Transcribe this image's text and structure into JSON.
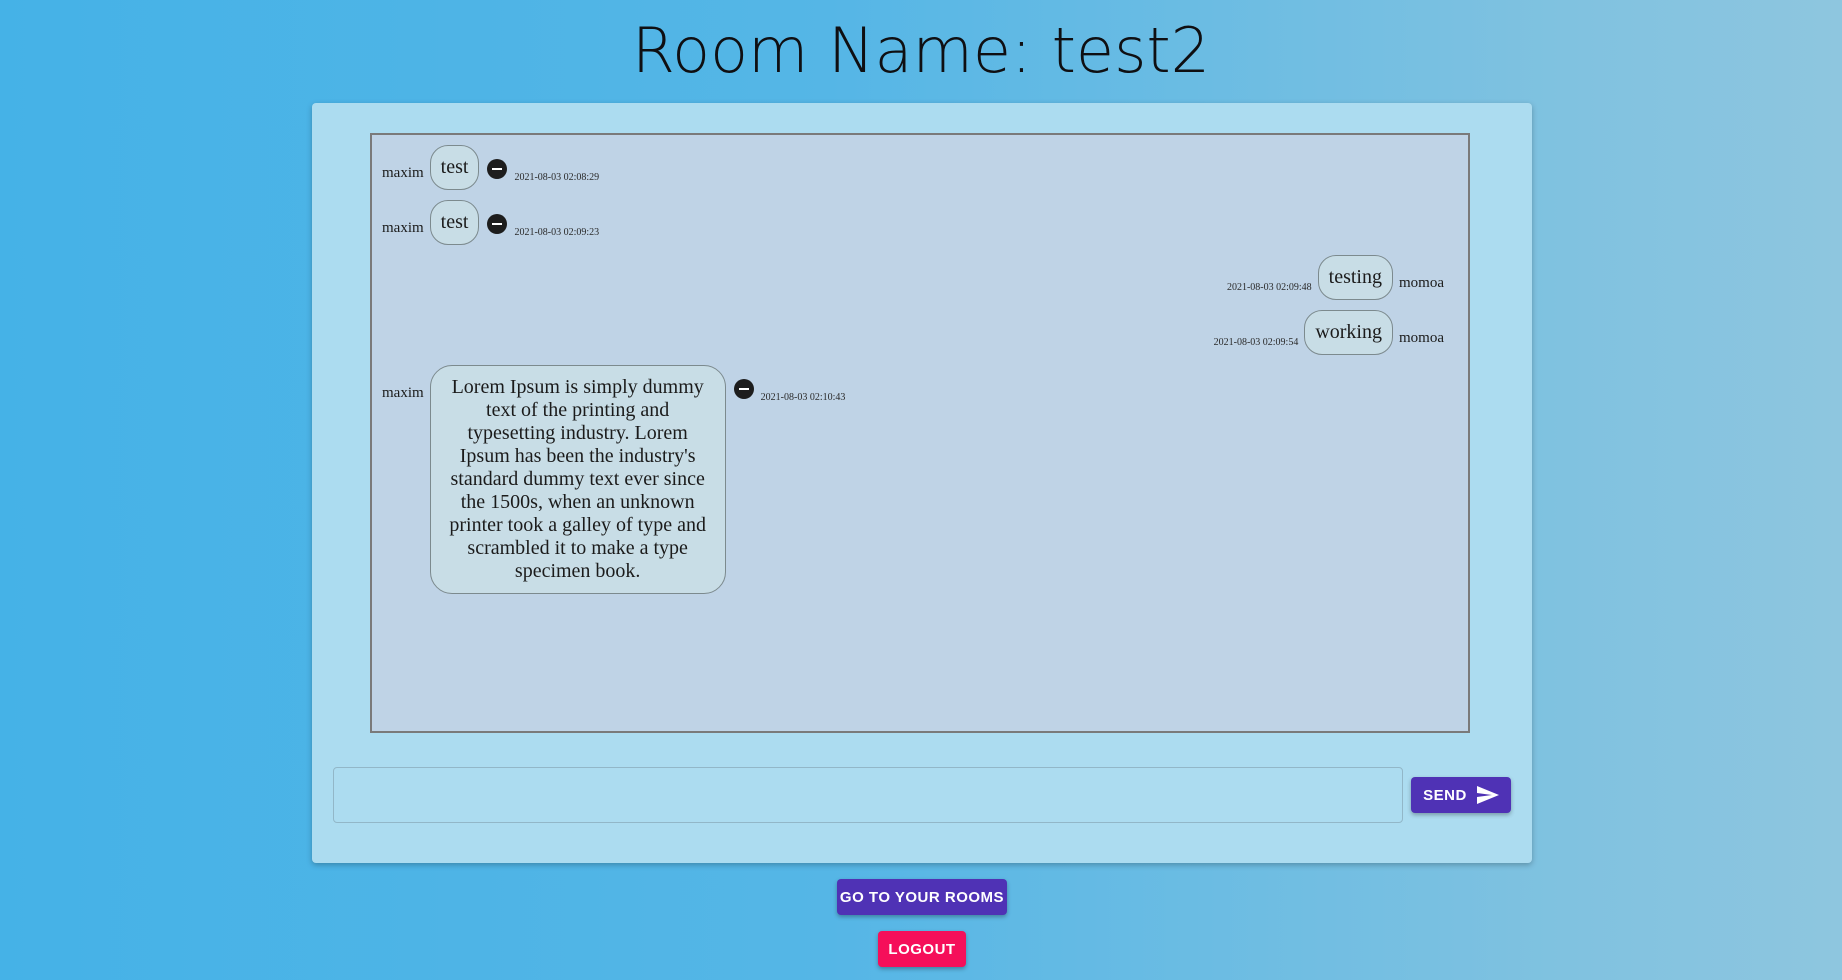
{
  "page": {
    "title": "Room Name: test2"
  },
  "messages": [
    {
      "sender": "maxim",
      "text": "test",
      "timestamp": "2021-08-03 02:08:29",
      "side": "left",
      "deletable": true
    },
    {
      "sender": "maxim",
      "text": "test",
      "timestamp": "2021-08-03 02:09:23",
      "side": "left",
      "deletable": true
    },
    {
      "sender": "momoa",
      "text": "testing",
      "timestamp": "2021-08-03 02:09:48",
      "side": "right",
      "deletable": false
    },
    {
      "sender": "momoa",
      "text": "working",
      "timestamp": "2021-08-03 02:09:54",
      "side": "right",
      "deletable": false
    },
    {
      "sender": "maxim",
      "text": "Lorem Ipsum is simply dummy text of the printing and typesetting industry. Lorem Ipsum has been the industry's standard dummy text ever since the 1500s, when an unknown printer took a galley of type and scrambled it to make a type specimen book.",
      "timestamp": "2021-08-03 02:10:43",
      "side": "left",
      "deletable": true
    }
  ],
  "composer": {
    "value": "",
    "send_label": "SEND",
    "send_icon": "send-icon"
  },
  "actions": {
    "rooms_label": "GO TO YOUR ROOMS",
    "logout_label": "LOGOUT"
  },
  "colors": {
    "primary": "#4f32b5",
    "logout": "#f50f5a",
    "card": "#acdcf0",
    "chat_bg": "#bfd3e6"
  }
}
